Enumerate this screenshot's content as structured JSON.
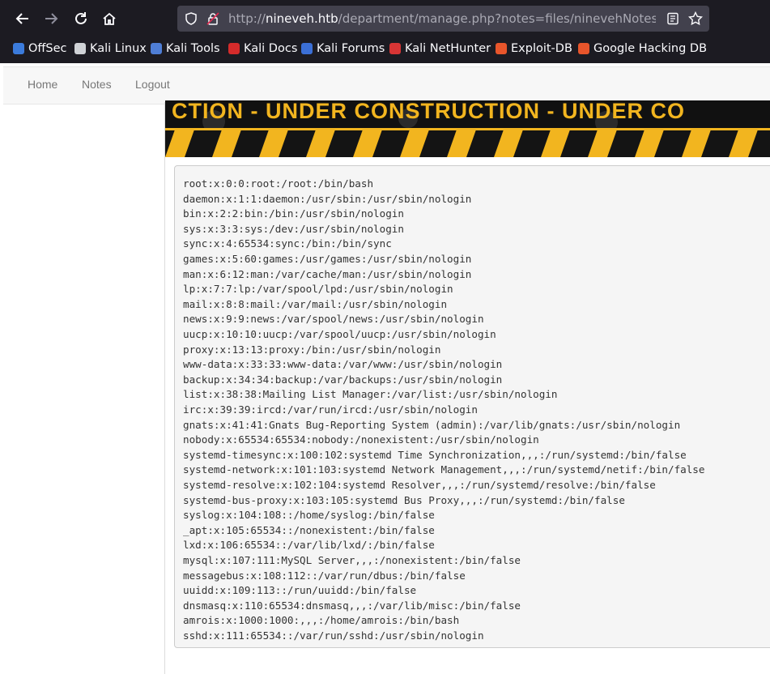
{
  "browser": {
    "url_prefix": "http://",
    "url_host": "nineveh.htb",
    "url_rest": "/department/manage.php?notes=files/ninevehNotes/../../../",
    "bookmarks": [
      {
        "label": "OffSec",
        "icon": "offsec-icon",
        "color": "#3b7bdc"
      },
      {
        "label": "Kali Linux",
        "icon": "kali-dragon-icon",
        "color": "#cfd2d6"
      },
      {
        "label": "Kali Tools",
        "icon": "kali-tools-icon",
        "color": "#4f7ed6"
      },
      {
        "label": "Kali Docs",
        "icon": "kali-docs-icon",
        "color": "#d52b2b"
      },
      {
        "label": "Kali Forums",
        "icon": "kali-forums-icon",
        "color": "#3b6fd6"
      },
      {
        "label": "Kali NetHunter",
        "icon": "nethunter-icon",
        "color": "#d83535"
      },
      {
        "label": "Exploit-DB",
        "icon": "exploitdb-icon",
        "color": "#e8552b"
      },
      {
        "label": "Google Hacking DB",
        "icon": "ghdb-icon",
        "color": "#e8552b"
      }
    ]
  },
  "nav": {
    "home": "Home",
    "notes": "Notes",
    "logout": "Logout"
  },
  "banner": {
    "text": "CTION - UNDER CONSTRUCTION - UNDER CO"
  },
  "output": {
    "lines": [
      "root:x:0:0:root:/root:/bin/bash",
      "daemon:x:1:1:daemon:/usr/sbin:/usr/sbin/nologin",
      "bin:x:2:2:bin:/bin:/usr/sbin/nologin",
      "sys:x:3:3:sys:/dev:/usr/sbin/nologin",
      "sync:x:4:65534:sync:/bin:/bin/sync",
      "games:x:5:60:games:/usr/games:/usr/sbin/nologin",
      "man:x:6:12:man:/var/cache/man:/usr/sbin/nologin",
      "lp:x:7:7:lp:/var/spool/lpd:/usr/sbin/nologin",
      "mail:x:8:8:mail:/var/mail:/usr/sbin/nologin",
      "news:x:9:9:news:/var/spool/news:/usr/sbin/nologin",
      "uucp:x:10:10:uucp:/var/spool/uucp:/usr/sbin/nologin",
      "proxy:x:13:13:proxy:/bin:/usr/sbin/nologin",
      "www-data:x:33:33:www-data:/var/www:/usr/sbin/nologin",
      "backup:x:34:34:backup:/var/backups:/usr/sbin/nologin",
      "list:x:38:38:Mailing List Manager:/var/list:/usr/sbin/nologin",
      "irc:x:39:39:ircd:/var/run/ircd:/usr/sbin/nologin",
      "gnats:x:41:41:Gnats Bug-Reporting System (admin):/var/lib/gnats:/usr/sbin/nologin",
      "nobody:x:65534:65534:nobody:/nonexistent:/usr/sbin/nologin",
      "systemd-timesync:x:100:102:systemd Time Synchronization,,,:/run/systemd:/bin/false",
      "systemd-network:x:101:103:systemd Network Management,,,:/run/systemd/netif:/bin/false",
      "systemd-resolve:x:102:104:systemd Resolver,,,:/run/systemd/resolve:/bin/false",
      "systemd-bus-proxy:x:103:105:systemd Bus Proxy,,,:/run/systemd:/bin/false",
      "syslog:x:104:108::/home/syslog:/bin/false",
      "_apt:x:105:65534::/nonexistent:/bin/false",
      "lxd:x:106:65534::/var/lib/lxd/:/bin/false",
      "mysql:x:107:111:MySQL Server,,,:/nonexistent:/bin/false",
      "messagebus:x:108:112::/var/run/dbus:/bin/false",
      "uuidd:x:109:113::/run/uuidd:/bin/false",
      "dnsmasq:x:110:65534:dnsmasq,,,:/var/lib/misc:/bin/false",
      "amrois:x:1000:1000:,,,:/home/amrois:/bin/bash",
      "sshd:x:111:65534::/var/run/sshd:/usr/sbin/nologin"
    ]
  }
}
